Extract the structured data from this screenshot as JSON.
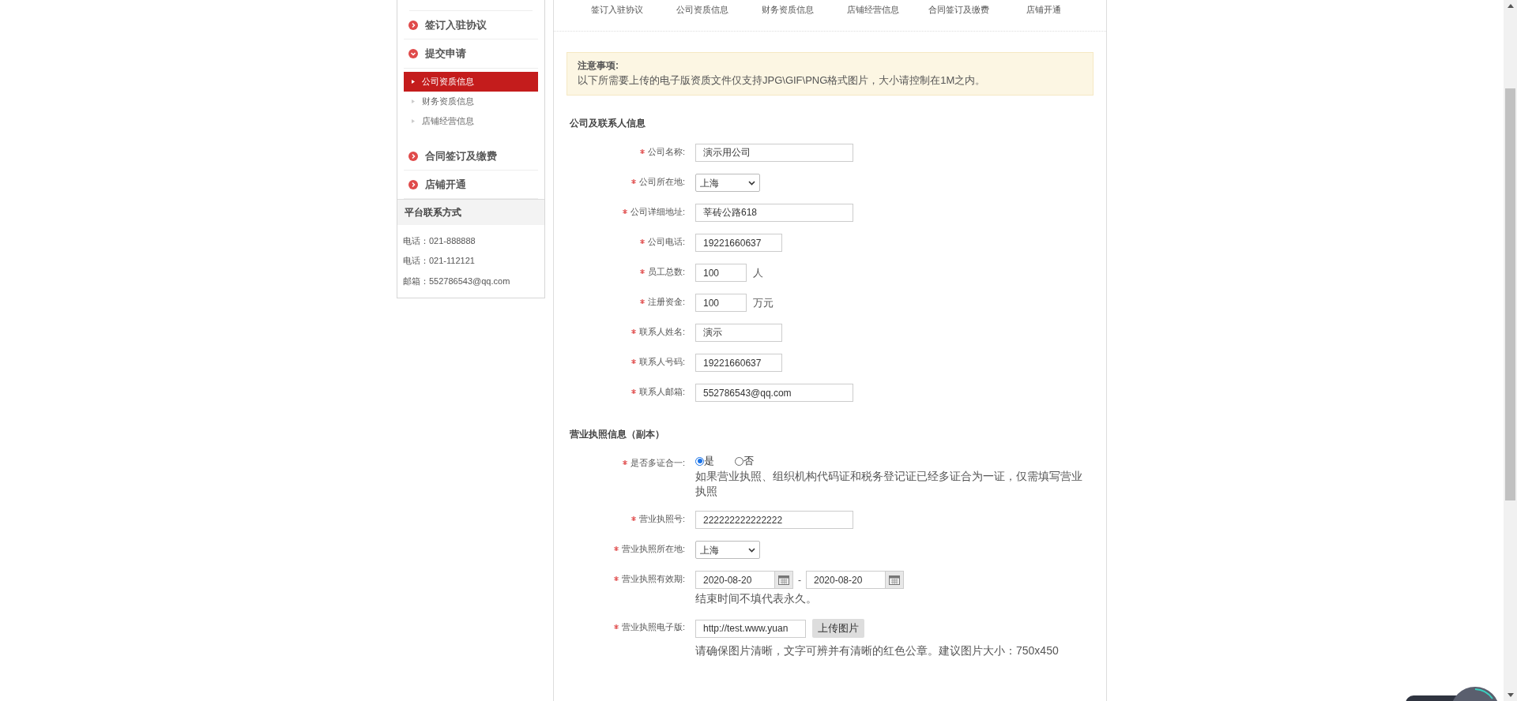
{
  "sidebar": {
    "steps": [
      {
        "label": "签订入驻协议",
        "expanded": false
      },
      {
        "label": "提交申请",
        "expanded": true,
        "children": [
          {
            "label": "公司资质信息",
            "selected": true
          },
          {
            "label": "财务资质信息",
            "selected": false
          },
          {
            "label": "店铺经营信息",
            "selected": false
          }
        ]
      },
      {
        "label": "合同签订及缴费",
        "expanded": false
      },
      {
        "label": "店铺开通",
        "expanded": false
      }
    ],
    "contact": {
      "title": "平台联系方式",
      "lines": [
        "电话：021-888888",
        "电话：021-112121",
        "邮箱：552786543@qq.com"
      ]
    }
  },
  "tabs": [
    "签订入驻协议",
    "公司资质信息",
    "财务资质信息",
    "店铺经营信息",
    "合同签订及缴费",
    "店铺开通"
  ],
  "notice": {
    "title": "注意事项:",
    "text": "以下所需要上传的电子版资质文件仅支持JPG\\GIF\\PNG格式图片，大小请控制在1M之内。"
  },
  "sections": [
    {
      "title": "公司及联系人信息",
      "fields": [
        {
          "kind": "longtext",
          "label": "公司名称:",
          "required": true,
          "value": "演示用公司"
        },
        {
          "kind": "select",
          "label": "公司所在地:",
          "required": true,
          "value": "上海"
        },
        {
          "kind": "longtext",
          "label": "公司详细地址:",
          "required": true,
          "value": "莘砖公路618"
        },
        {
          "kind": "text",
          "label": "公司电话:",
          "required": true,
          "value": "19221660637"
        },
        {
          "kind": "shorttext",
          "label": "员工总数:",
          "required": true,
          "value": "100",
          "unit": "人"
        },
        {
          "kind": "shorttext",
          "label": "注册资金:",
          "required": true,
          "value": "100",
          "unit": "万元"
        },
        {
          "kind": "text",
          "label": "联系人姓名:",
          "required": true,
          "value": "演示"
        },
        {
          "kind": "text",
          "label": "联系人号码:",
          "required": true,
          "value": "19221660637"
        },
        {
          "kind": "longtext",
          "label": "联系人邮箱:",
          "required": true,
          "value": "552786543@qq.com"
        }
      ]
    },
    {
      "title": "营业执照信息（副本）",
      "fields": [
        {
          "kind": "radio",
          "label": "是否多证合一:",
          "required": true,
          "options": [
            {
              "label": "是",
              "selected": true
            },
            {
              "label": "否",
              "selected": false
            }
          ],
          "hint": "如果营业执照、组织机构代码证和税务登记证已经多证合为一证，仅需填写营业执照"
        },
        {
          "kind": "longtext",
          "label": "营业执照号:",
          "required": true,
          "value": "222222222222222"
        },
        {
          "kind": "select",
          "label": "营业执照所在地:",
          "required": true,
          "value": "上海"
        },
        {
          "kind": "daterange",
          "label": "营业执照有效期:",
          "required": true,
          "start": "2020-08-20",
          "separator": "-",
          "end": "2020-08-20",
          "hint": "结束时间不填代表永久。"
        },
        {
          "kind": "upload",
          "label": "营业执照电子版:",
          "required": true,
          "value": "http://test.www.yuan",
          "button": "上传图片",
          "hint": "请确保图片清晰，文字可辨并有清晰的红色公章。建议图片大小：750x450"
        }
      ]
    }
  ]
}
